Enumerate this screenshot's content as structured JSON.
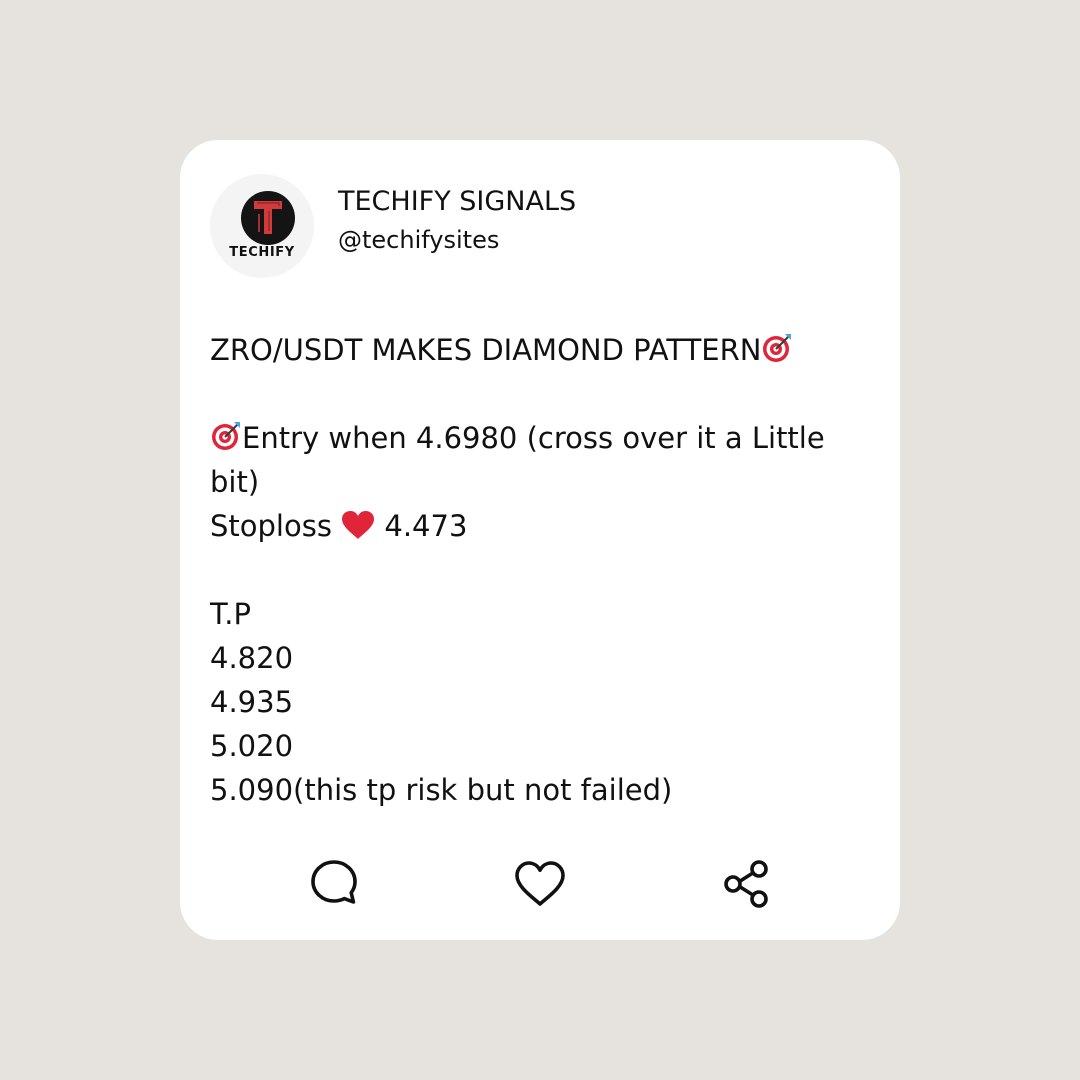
{
  "post": {
    "author": {
      "display_name": "TECHIFY SIGNALS",
      "handle": "@techifysites",
      "avatar_text": "TECHIFY",
      "avatar_letter": "T"
    },
    "body": {
      "title": "ZRO/USDT MAKES DIAMOND PATTERN",
      "title_icon": "direct-hit-emoji",
      "entry": "Entry when 4.6980 (cross over it a Little bit)",
      "entry_icon": "direct-hit-emoji",
      "stoploss_label": "Stoploss",
      "stoploss_icon": "red-heart-emoji",
      "stoploss_value": "4.473",
      "tp_label": "T.P",
      "targets": [
        "4.820",
        "4.935",
        "5.020",
        "5.090(this tp risk but not failed)"
      ]
    },
    "actions": [
      "comment-icon",
      "like-icon",
      "share-icon"
    ]
  },
  "colors": {
    "background": "#e6e3df",
    "card": "#ffffff",
    "logo_red": "#d23b3b",
    "heart_red": "#e0243a"
  }
}
